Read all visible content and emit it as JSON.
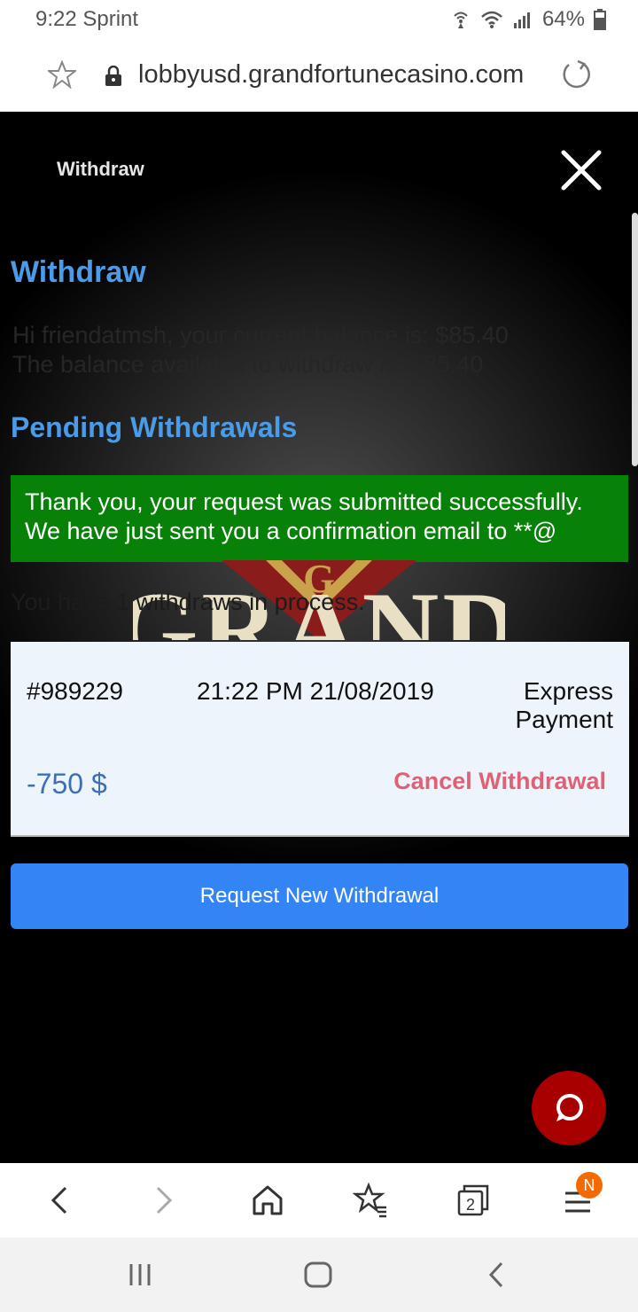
{
  "status_bar": {
    "time_carrier": "9:22 Sprint",
    "battery": "64%"
  },
  "browser": {
    "url": "lobbyusd.grandfortunecasino.com",
    "tabs_count": "2",
    "menu_badge": "N"
  },
  "modal": {
    "title": "Withdraw",
    "heading": "Withdraw",
    "balance_line1": "Hi friendatmsh, your current balance is: $85.40",
    "balance_line2": "The balance available to withdraw is: $85.40",
    "pending_heading": "Pending Withdrawals",
    "success_line1": "Thank you, your request was submitted successfully.",
    "success_line2": "We have just sent you a confirmation email to **@",
    "in_process_text": "You have 1 withdraws in process.",
    "withdrawal": {
      "id": "#989229",
      "datetime": "21:22 PM 21/08/2019",
      "method": "Express Payment",
      "amount": "-750 $",
      "cancel_label": "Cancel Withdrawal"
    },
    "request_button_label": "Request New Withdrawal"
  },
  "colors": {
    "heading_blue": "#4a9be8",
    "success_green": "#078107",
    "button_blue": "#3384f5",
    "cancel_red": "#e06076",
    "chat_red": "#a80000"
  }
}
